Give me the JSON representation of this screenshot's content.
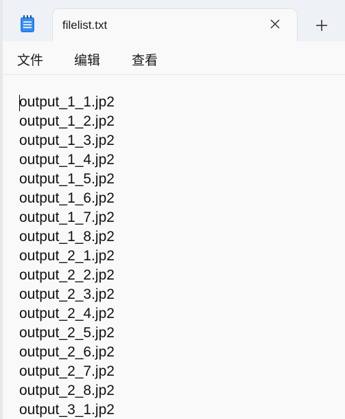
{
  "tab": {
    "title": "filelist.txt",
    "close_icon": "close-icon",
    "new_tab_icon": "plus-icon"
  },
  "app_icon": "notepad-icon",
  "menu": {
    "items": [
      {
        "label": "文件"
      },
      {
        "label": "编辑"
      },
      {
        "label": "查看"
      }
    ]
  },
  "editor": {
    "lines": [
      "output_1_1.jp2",
      "output_1_2.jp2",
      "output_1_3.jp2",
      "output_1_4.jp2",
      "output_1_5.jp2",
      "output_1_6.jp2",
      "output_1_7.jp2",
      "output_1_8.jp2",
      "output_2_1.jp2",
      "output_2_2.jp2",
      "output_2_3.jp2",
      "output_2_4.jp2",
      "output_2_5.jp2",
      "output_2_6.jp2",
      "output_2_7.jp2",
      "output_2_8.jp2",
      "output_3_1.jp2"
    ]
  },
  "colors": {
    "accent": "#1f6fd6",
    "titlebar": "#eef1f6",
    "editor_bg": "#f9f9f9"
  }
}
